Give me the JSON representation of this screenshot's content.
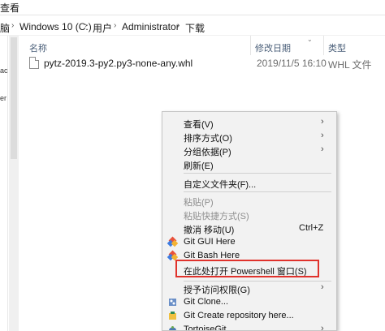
{
  "ribbon": {
    "tab_label": "查看"
  },
  "address": {
    "left_fragment": "脑",
    "crumbs": [
      "Windows 10 (C:)",
      "用户",
      "Administrator",
      "下载"
    ]
  },
  "navpane": {
    "fragments": [
      "ac",
      "er"
    ]
  },
  "columns": {
    "name": "名称",
    "date": "修改日期",
    "type": "类型"
  },
  "files": [
    {
      "name": "pytz-2019.3-py2.py3-none-any.whl",
      "date": "2019/11/5 16:10",
      "type": "WHL 文件"
    }
  ],
  "menu": {
    "view": "查看(V)",
    "sort": "排序方式(O)",
    "group": "分组依据(P)",
    "refresh": "刷新(E)",
    "customize": "自定义文件夹(F)...",
    "paste": "粘贴(P)",
    "paste_shortcut": "粘贴快捷方式(S)",
    "undo_move": "撤消 移动(U)",
    "undo_shortcut": "Ctrl+Z",
    "git_gui": "Git GUI Here",
    "git_bash": "Git Bash Here",
    "powershell": "在此处打开 Powershell 窗口(S)",
    "give_access": "授予访问权限(G)",
    "git_clone": "Git Clone...",
    "git_create_repo": "Git Create repository here...",
    "tortoisegit": "TortoiseGit"
  },
  "colors": {
    "highlight_border": "#e0322c",
    "menu_bg": "#f2f2f2",
    "header_text": "#4c607a"
  }
}
